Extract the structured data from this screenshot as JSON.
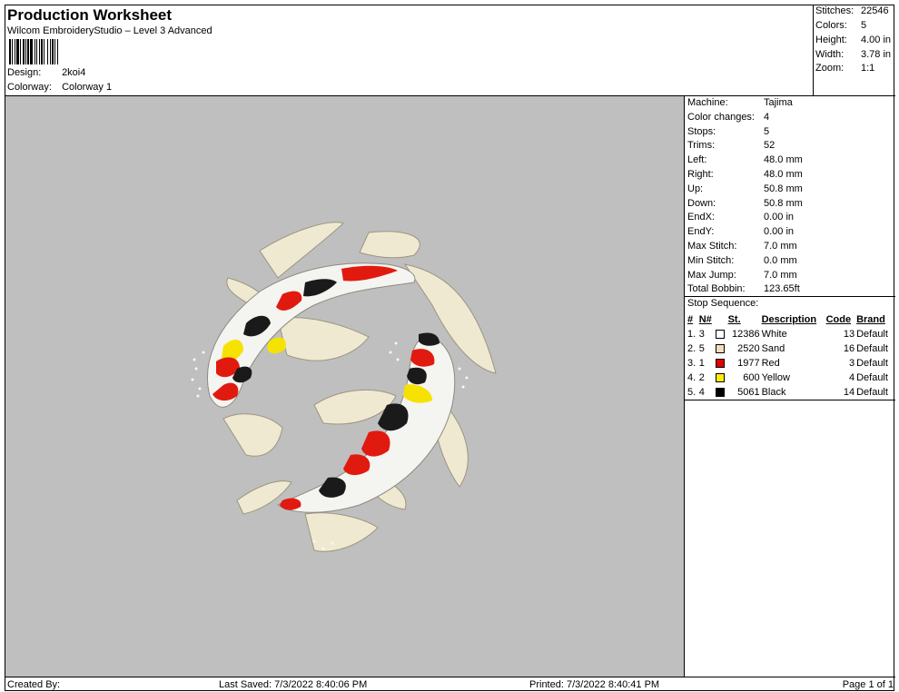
{
  "header": {
    "title": "Production Worksheet",
    "subtitle": "Wilcom EmbroideryStudio – Level 3 Advanced",
    "design_label": "Design:",
    "design_value": "2koi4",
    "colorway_label": "Colorway:",
    "colorway_value": "Colorway 1"
  },
  "summary": [
    {
      "label": "Stitches:",
      "value": "22546"
    },
    {
      "label": "Colors:",
      "value": "5"
    },
    {
      "label": "Height:",
      "value": "4.00 in"
    },
    {
      "label": "Width:",
      "value": "3.78 in"
    },
    {
      "label": "Zoom:",
      "value": "1:1"
    }
  ],
  "machine_info": [
    {
      "label": "Machine:",
      "value": "Tajima"
    },
    {
      "label": "Color changes:",
      "value": "4"
    },
    {
      "label": "Stops:",
      "value": "5"
    },
    {
      "label": "Trims:",
      "value": "52"
    },
    {
      "label": "Left:",
      "value": "48.0 mm"
    },
    {
      "label": "Right:",
      "value": "48.0 mm"
    },
    {
      "label": "Up:",
      "value": "50.8 mm"
    },
    {
      "label": "Down:",
      "value": "50.8 mm"
    },
    {
      "label": "EndX:",
      "value": "0.00 in"
    },
    {
      "label": "EndY:",
      "value": "0.00 in"
    },
    {
      "label": "Max Stitch:",
      "value": "7.0 mm"
    },
    {
      "label": "Min Stitch:",
      "value": "0.0 mm"
    },
    {
      "label": "Max Jump:",
      "value": "7.0 mm"
    },
    {
      "label": "Total Bobbin:",
      "value": "123.65ft"
    }
  ],
  "stop_sequence": {
    "title": "Stop Sequence:",
    "columns": [
      "#",
      "N#",
      "St.",
      "Description",
      "Code",
      "Brand"
    ],
    "rows": [
      {
        "num": "1.",
        "n": "3",
        "color": "#ffffff",
        "st": "12386",
        "desc": "White",
        "code": "13",
        "brand": "Default"
      },
      {
        "num": "2.",
        "n": "5",
        "color": "#f3dcc0",
        "st": "2520",
        "desc": "Sand",
        "code": "16",
        "brand": "Default"
      },
      {
        "num": "3.",
        "n": "1",
        "color": "#e00000",
        "st": "1977",
        "desc": "Red",
        "code": "3",
        "brand": "Default"
      },
      {
        "num": "4.",
        "n": "2",
        "color": "#ffee00",
        "st": "600",
        "desc": "Yellow",
        "code": "4",
        "brand": "Default"
      },
      {
        "num": "5.",
        "n": "4",
        "color": "#000000",
        "st": "5061",
        "desc": "Black",
        "code": "14",
        "brand": "Default"
      }
    ]
  },
  "footer": {
    "created_by": "Created By:",
    "last_saved": "Last Saved: 7/3/2022 8:40:06 PM",
    "printed": "Printed: 7/3/2022 8:40:41 PM",
    "page": "Page 1 of 1"
  },
  "colors": {
    "design_background": "#bfbfbf",
    "fin": "#efe9d2",
    "body": "#f4f4f0",
    "red": "#e11a10",
    "yellow": "#f6e200",
    "black": "#1a1a1a"
  }
}
